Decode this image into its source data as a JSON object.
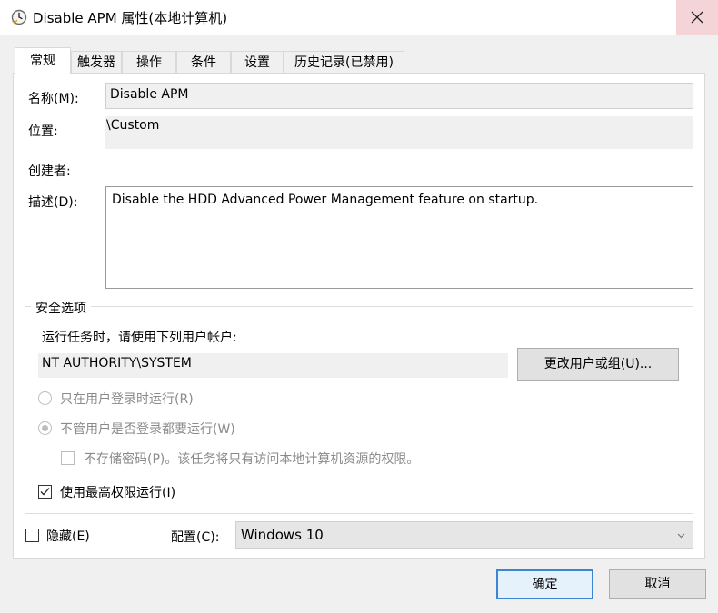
{
  "window": {
    "title": "Disable APM 属性(本地计算机)",
    "title_icon": "clock-icon",
    "close_icon": "close-icon"
  },
  "tabs": [
    {
      "label": "常规",
      "active": true
    },
    {
      "label": "触发器",
      "active": false
    },
    {
      "label": "操作",
      "active": false
    },
    {
      "label": "条件",
      "active": false
    },
    {
      "label": "设置",
      "active": false
    },
    {
      "label": "历史记录(已禁用)",
      "active": false
    }
  ],
  "general": {
    "name_label": "名称(M):",
    "name_value": "Disable APM",
    "location_label": "位置:",
    "location_value": "\\Custom",
    "author_label": "创建者:",
    "description_label": "描述(D):",
    "description_value": "Disable the HDD Advanced Power Management feature on startup."
  },
  "security": {
    "group_label": "安全选项",
    "run_as_prompt": "运行任务时，请使用下列用户帐户:",
    "user_account": "NT AUTHORITY\\SYSTEM",
    "change_user_button": "更改用户或组(U)...",
    "radio_logged_on": {
      "label": "只在用户登录时运行(R)",
      "selected": false,
      "enabled": false
    },
    "radio_whether_logged": {
      "label": "不管用户是否登录都要运行(W)",
      "selected": true,
      "enabled": false
    },
    "checkbox_no_store_password": {
      "label": "不存储密码(P)。该任务将只有访问本地计算机资源的权限。",
      "checked": false,
      "enabled": false
    },
    "checkbox_highest_privileges": {
      "label": "使用最高权限运行(I)",
      "checked": true,
      "enabled": true
    }
  },
  "bottom": {
    "hidden_label": "隐藏(E)",
    "hidden_checked": false,
    "config_label": "配置(C):",
    "config_value": "Windows 10"
  },
  "buttons": {
    "ok": "确定",
    "cancel": "取消"
  },
  "colors": {
    "accent_focus": "#3a86d4",
    "close_hover_bg": "#f5d4d8"
  }
}
